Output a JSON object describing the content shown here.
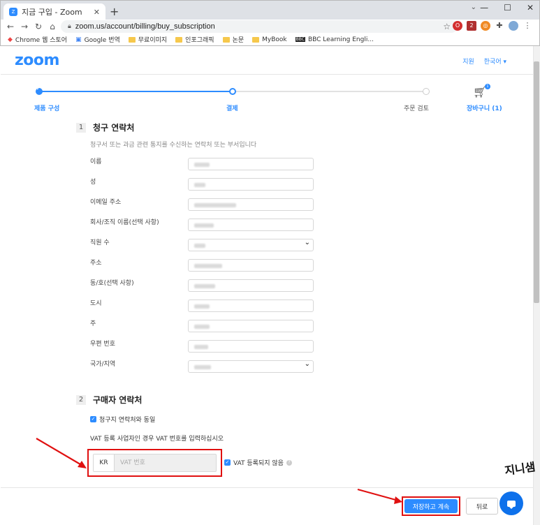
{
  "browser": {
    "tab_title": "지금 구입 - Zoom",
    "tab_favicon": "Z",
    "url": "zoom.us/account/billing/buy_subscription",
    "bookmarks": [
      "Chrome 웹 스토어",
      "Google 번역",
      "무료이미지",
      "인포그래픽",
      "논문",
      "MyBook",
      "BBC Learning Engli..."
    ],
    "window_controls": [
      "—",
      "☐",
      "✕"
    ]
  },
  "header": {
    "logo": "zoom",
    "support": "지원",
    "language": "한국어 ▾"
  },
  "steps": {
    "items": [
      "제품 구성",
      "결제",
      "주문 검토"
    ],
    "cart_label": "장바구니 (1)",
    "cart_count": "1",
    "progress_fraction": 0.5
  },
  "billing": {
    "number": "1",
    "title": "청구 연락처",
    "description": "청구서 또는 과금 관련 통지를 수신하는 연락처 또는 부서입니다",
    "fields": [
      {
        "label": "이름",
        "type": "text"
      },
      {
        "label": "성",
        "type": "text"
      },
      {
        "label": "이메일 주소",
        "type": "text"
      },
      {
        "label": "회사/조직 이름(선택 사항)",
        "type": "text"
      },
      {
        "label": "직원 수",
        "type": "select"
      },
      {
        "label": "주소",
        "type": "text"
      },
      {
        "label": "동/호(선택 사항)",
        "type": "text"
      },
      {
        "label": "도시",
        "type": "text"
      },
      {
        "label": "주",
        "type": "text"
      },
      {
        "label": "우편 번호",
        "type": "text"
      },
      {
        "label": "국가/지역",
        "type": "select"
      }
    ]
  },
  "buyer": {
    "number": "2",
    "title": "구매자 연락처",
    "same_as_billing": "청구지 연락처와 동일",
    "vat_hint": "VAT 등록 사업자인 경우 VAT 번호를 입력하십시오",
    "vat_country": "KR",
    "vat_placeholder": "VAT 번호",
    "vat_not_registered": "VAT 등록되지 않음"
  },
  "footer": {
    "save_continue": "저장하고 계속",
    "back": "뒤로"
  },
  "colors": {
    "accent": "#2d8cff",
    "annotation": "#e01010"
  },
  "watermark": "지니샘"
}
